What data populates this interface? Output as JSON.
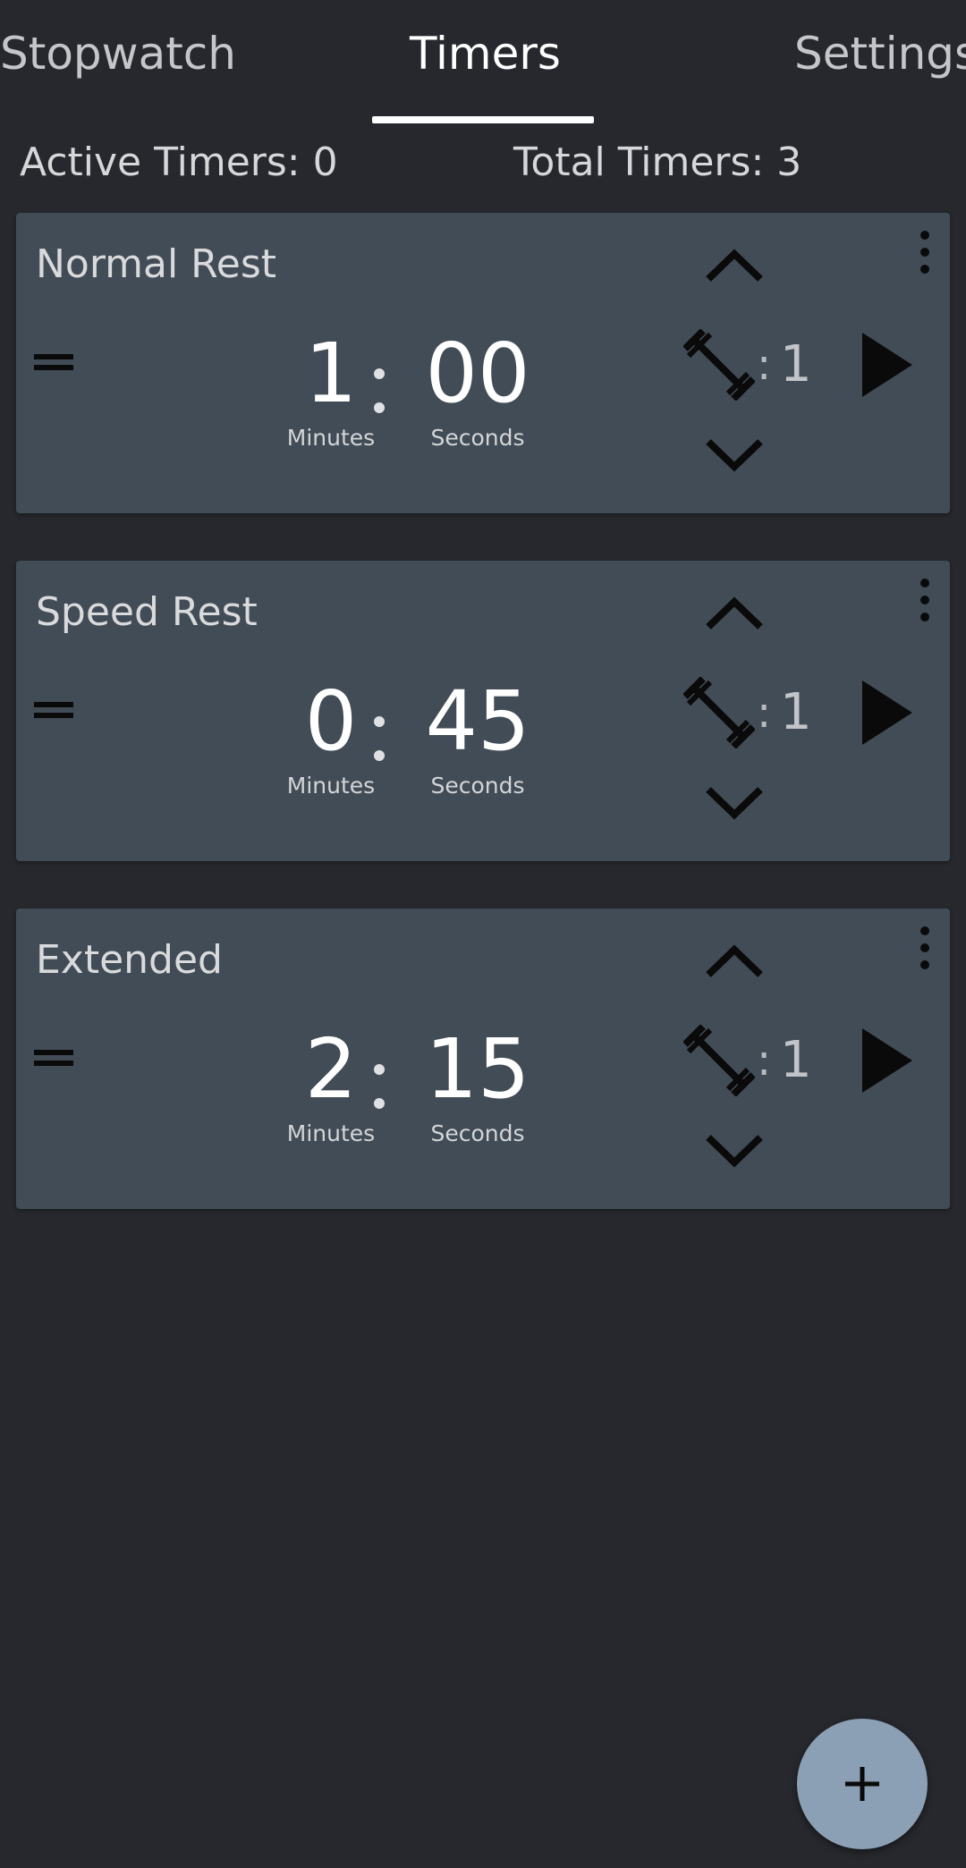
{
  "tabs": {
    "stopwatch": "Stopwatch",
    "timers": "Timers",
    "settings": "Settings"
  },
  "summary": {
    "active": "Active Timers: 0",
    "total": "Total Timers: 3"
  },
  "labels": {
    "minutes": "Minutes",
    "seconds": "Seconds",
    "colon": ":"
  },
  "timers": [
    {
      "name": "Normal Rest",
      "minutes": "1",
      "seconds": "00",
      "sets": "1"
    },
    {
      "name": "Speed Rest",
      "minutes": "0",
      "seconds": "45",
      "sets": "1"
    },
    {
      "name": "Extended",
      "minutes": "2",
      "seconds": "15",
      "sets": "1"
    }
  ],
  "icons": {
    "drag": "drag-handle-icon",
    "sets": "dumbbell-icon",
    "increase": "chevron-up-icon",
    "decrease": "chevron-down-icon",
    "play": "play-icon",
    "more": "more-vert-icon",
    "add": "plus-icon"
  },
  "colors": {
    "background": "#26282d",
    "card": "#424c56",
    "fab": "#8ca0b5",
    "active_tab": "#ffffff"
  }
}
